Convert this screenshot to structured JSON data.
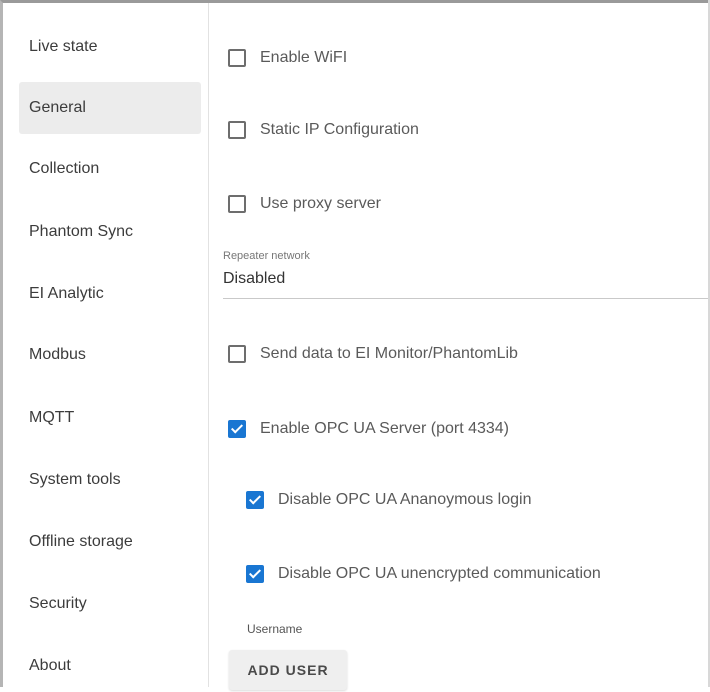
{
  "sidebar": {
    "items": [
      {
        "label": "Live state",
        "active": false
      },
      {
        "label": "General",
        "active": true
      },
      {
        "label": "Collection",
        "active": false
      },
      {
        "label": "Phantom Sync",
        "active": false
      },
      {
        "label": "EI Analytic",
        "active": false
      },
      {
        "label": "Modbus",
        "active": false
      },
      {
        "label": "MQTT",
        "active": false
      },
      {
        "label": "System tools",
        "active": false
      },
      {
        "label": "Offline storage",
        "active": false
      },
      {
        "label": "Security",
        "active": false
      },
      {
        "label": "About",
        "active": false
      }
    ]
  },
  "main": {
    "enable_wifi": {
      "label": "Enable WiFI",
      "checked": false
    },
    "static_ip": {
      "label": "Static IP Configuration",
      "checked": false
    },
    "use_proxy": {
      "label": "Use proxy server",
      "checked": false
    },
    "repeater": {
      "label": "Repeater network",
      "value": "Disabled"
    },
    "send_data": {
      "label": "Send data to EI Monitor/PhantomLib",
      "checked": false
    },
    "opc_ua_server": {
      "label": "Enable OPC UA Server (port 4334)",
      "checked": true
    },
    "opc_anon": {
      "label": "Disable OPC UA Ananoymous login",
      "checked": true
    },
    "opc_unencrypted": {
      "label": "Disable OPC UA unencrypted communication",
      "checked": true
    },
    "username_label": "Username",
    "add_user_label": "ADD USER"
  },
  "colors": {
    "accent": "#1976d2",
    "active_nav": "#ececec"
  }
}
